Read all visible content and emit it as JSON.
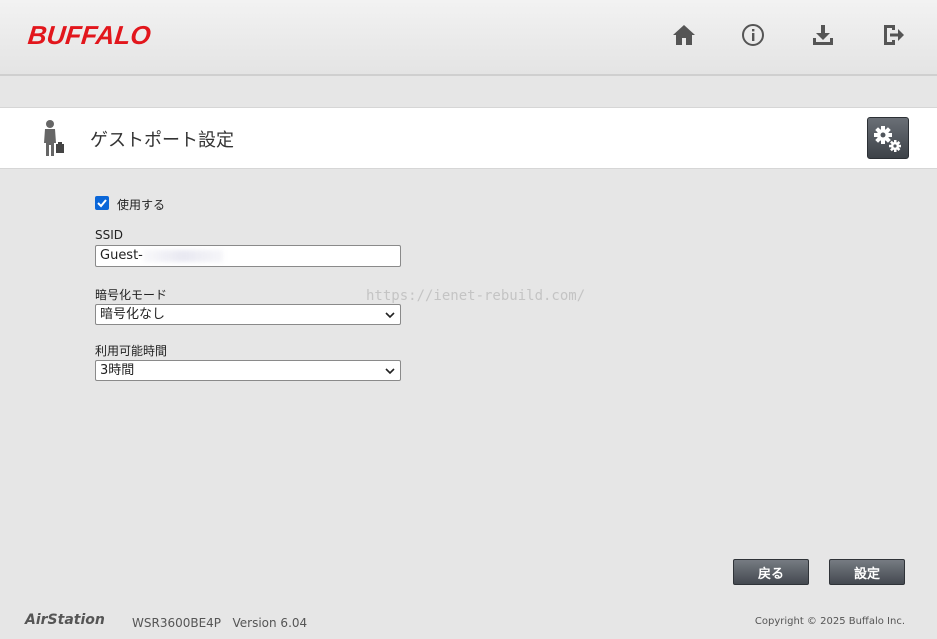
{
  "header": {
    "logo": "BUFFALO",
    "icons": [
      "home-icon",
      "info-icon",
      "download-icon",
      "logout-icon"
    ]
  },
  "page": {
    "title": "ゲストポート設定",
    "icon": "person-with-bag-icon"
  },
  "form": {
    "enable": {
      "label": "使用する",
      "checked": true
    },
    "ssid": {
      "label": "SSID",
      "value": "Guest-"
    },
    "encryption": {
      "label": "暗号化モード",
      "selected": "暗号化なし"
    },
    "duration": {
      "label": "利用可能時間",
      "selected": "3時間"
    }
  },
  "watermark": "https://ienet-rebuild.com/",
  "buttons": {
    "back": "戻る",
    "apply": "設定"
  },
  "footer": {
    "brand": "AirStation",
    "model": "WSR3600BE4P   Version 6.04",
    "copyright": "Copyright © 2025 Buffalo Inc."
  },
  "colors": {
    "brand_red": "#e2161c",
    "checkbox_blue": "#0a66d8",
    "button_dark": "#4a4f56"
  }
}
